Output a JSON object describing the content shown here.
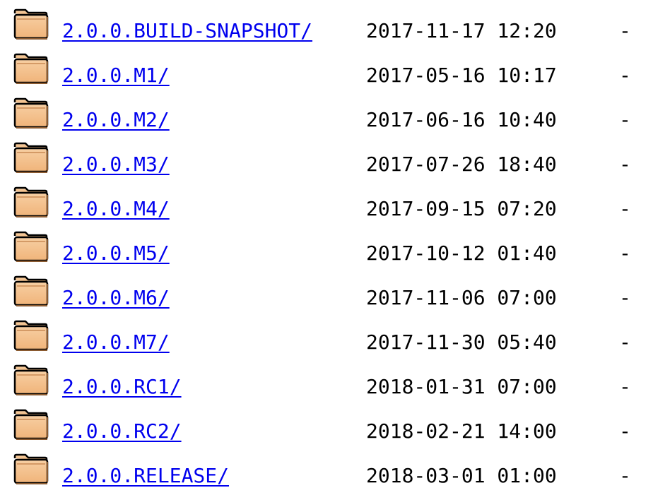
{
  "icons": {
    "folder": "folder-icon",
    "folder_fill": "#f0b47a",
    "folder_border": "#000000"
  },
  "link_color": "#0000ee",
  "entries": [
    {
      "name": "2.0.0.BUILD-SNAPSHOT/",
      "modified": "2017-11-17 12:20",
      "size": "-"
    },
    {
      "name": "2.0.0.M1/",
      "modified": "2017-05-16 10:17",
      "size": "-"
    },
    {
      "name": "2.0.0.M2/",
      "modified": "2017-06-16 10:40",
      "size": "-"
    },
    {
      "name": "2.0.0.M3/",
      "modified": "2017-07-26 18:40",
      "size": "-"
    },
    {
      "name": "2.0.0.M4/",
      "modified": "2017-09-15 07:20",
      "size": "-"
    },
    {
      "name": "2.0.0.M5/",
      "modified": "2017-10-12 01:40",
      "size": "-"
    },
    {
      "name": "2.0.0.M6/",
      "modified": "2017-11-06 07:00",
      "size": "-"
    },
    {
      "name": "2.0.0.M7/",
      "modified": "2017-11-30 05:40",
      "size": "-"
    },
    {
      "name": "2.0.0.RC1/",
      "modified": "2018-01-31 07:00",
      "size": "-"
    },
    {
      "name": "2.0.0.RC2/",
      "modified": "2018-02-21 14:00",
      "size": "-"
    },
    {
      "name": "2.0.0.RELEASE/",
      "modified": "2018-03-01 01:00",
      "size": "-"
    }
  ]
}
